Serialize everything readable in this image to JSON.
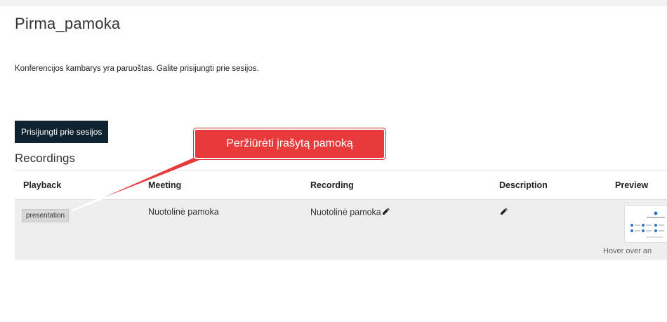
{
  "page": {
    "title": "Pirma_pamoka",
    "notice": "Konferencijos kambarys yra paruoštas. Galite prisijungti prie sesijos.",
    "join_button": "Prisijungti prie sesijos"
  },
  "recordings": {
    "heading": "Recordings",
    "columns": [
      "Playback",
      "Meeting",
      "Recording",
      "Description",
      "Preview"
    ],
    "rows": [
      {
        "playback": "presentation",
        "meeting": "Nuotolinė pamoka",
        "recording": "Nuotolinė pamoka",
        "description": "",
        "preview_hint": "Hover over an"
      }
    ]
  },
  "callout": {
    "text": "Peržiūrėti įrašytą pamoką",
    "color": "#e8393b"
  },
  "icons": {
    "edit_recording": "pencil-icon",
    "edit_description": "pencil-icon"
  }
}
